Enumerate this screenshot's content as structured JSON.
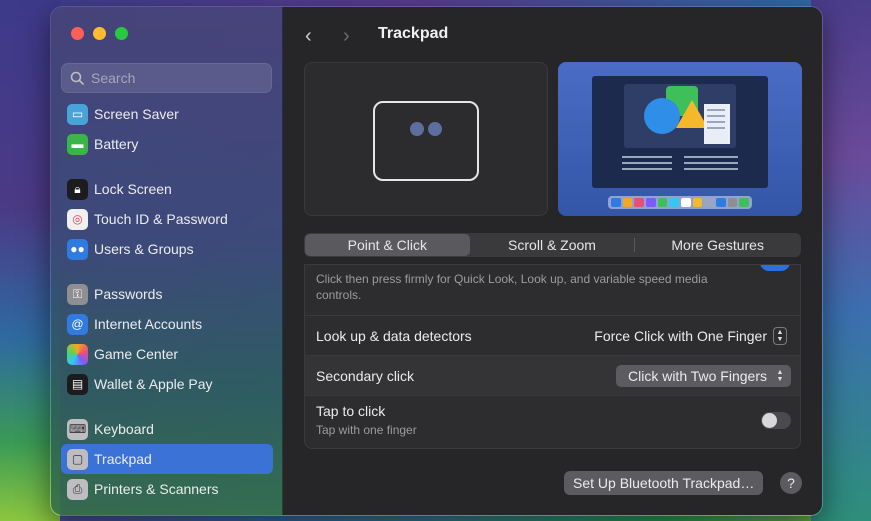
{
  "sidebar": {
    "search_placeholder": "Search",
    "items": [
      {
        "label": "Screen Saver",
        "icon": "screen-saver-icon",
        "color": "#4aa3d8"
      },
      {
        "label": "Battery",
        "icon": "battery-icon",
        "color": "#3bb54a"
      },
      {
        "label": "Lock Screen",
        "icon": "lock-icon",
        "color": "#1c1c1e"
      },
      {
        "label": "Touch ID & Password",
        "icon": "fingerprint-icon",
        "color": "#f0f0f0"
      },
      {
        "label": "Users & Groups",
        "icon": "users-icon",
        "color": "#2f7be0"
      },
      {
        "label": "Passwords",
        "icon": "key-icon",
        "color": "#8e8e93"
      },
      {
        "label": "Internet Accounts",
        "icon": "at-icon",
        "color": "#2f7be0"
      },
      {
        "label": "Game Center",
        "icon": "game-center-icon",
        "color": "#e8e8e8"
      },
      {
        "label": "Wallet & Apple Pay",
        "icon": "wallet-icon",
        "color": "#1c1c1e"
      },
      {
        "label": "Keyboard",
        "icon": "keyboard-icon",
        "color": "#bdbdc2"
      },
      {
        "label": "Trackpad",
        "icon": "trackpad-icon",
        "color": "#bdbdc2"
      },
      {
        "label": "Printers & Scanners",
        "icon": "printer-icon",
        "color": "#bdbdc2"
      }
    ],
    "selected": "Trackpad"
  },
  "header": {
    "title": "Trackpad",
    "back_glyph": "‹",
    "forward_glyph": "›"
  },
  "tabs": [
    {
      "label": "Point & Click",
      "active": true
    },
    {
      "label": "Scroll & Zoom",
      "active": false
    },
    {
      "label": "More Gestures",
      "active": false
    }
  ],
  "settings": {
    "force_click_desc": "Click then press firmly for Quick Look, Look up, and variable speed media controls.",
    "lookup": {
      "label": "Look up & data detectors",
      "value": "Force Click with One Finger"
    },
    "secondary": {
      "label": "Secondary click",
      "value": "Click with Two Fingers"
    },
    "tap": {
      "label": "Tap to click",
      "desc": "Tap with one finger",
      "enabled": false
    }
  },
  "footer": {
    "bluetooth_button": "Set Up Bluetooth Trackpad…",
    "help_button": "?"
  },
  "colors": {
    "accent": "#3a72d6",
    "toggle_on": "#2f6fd9"
  }
}
